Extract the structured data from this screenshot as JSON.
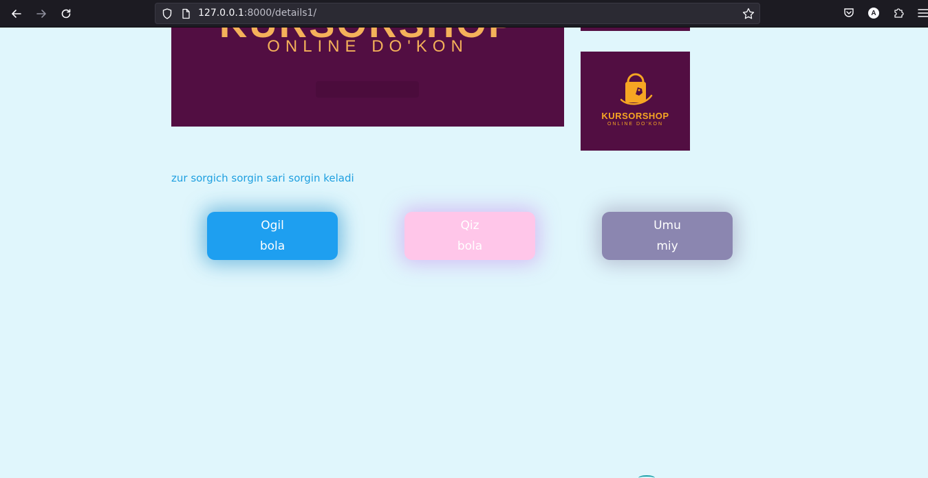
{
  "browser": {
    "url_host": "127.0.0.1",
    "url_rest": ":8000/details1/",
    "profile_initial": "A"
  },
  "banner": {
    "big_text": "KURSORSHOP",
    "subtitle": "ONLINE DO'KON"
  },
  "side_logo": {
    "name": "KURSORSHOP",
    "tagline": "ONLINE DO'KON"
  },
  "description": "zur sorgich sorgin sari sorgin keladi",
  "categories": [
    {
      "label": "Ogil bola",
      "color": "#1e9ff0"
    },
    {
      "label": "Qiz bola",
      "color": "#ffc6e9"
    },
    {
      "label": "Umu miy",
      "color": "#8b86b0"
    }
  ],
  "colors": {
    "background": "#e0f6fc",
    "brand_purple": "#520e42",
    "brand_orange": "#f6a623",
    "link_blue": "#1e9fe0"
  }
}
